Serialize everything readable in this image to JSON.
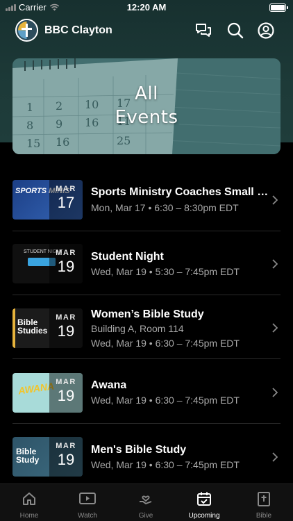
{
  "status_bar": {
    "carrier": "Carrier",
    "time": "12:20 AM"
  },
  "header": {
    "title": "BBC Clayton",
    "icons": [
      "chat-icon",
      "search-icon",
      "profile-icon"
    ]
  },
  "banner": {
    "title_line1": "All",
    "title_line2": "Events"
  },
  "events": [
    {
      "title": "Sports Ministry Coaches Small Group",
      "line1": "Mon, Mar 17 • 6:30 – 8:30pm EDT",
      "line2": "",
      "month": "MAR",
      "day": "17",
      "thumb_text": "SPORTS MINIS"
    },
    {
      "title": "Student Night",
      "line1": "Wed, Mar 19 • 5:30 – 7:45pm EDT",
      "line2": "",
      "month": "MAR",
      "day": "19",
      "thumb_text": "STUDENT NIGHT"
    },
    {
      "title": "Women’s Bible Study",
      "line1": "Building A, Room 114",
      "line2": "Wed, Mar 19 • 6:30 – 7:45pm EDT",
      "month": "MAR",
      "day": "19",
      "thumb_text": "Bible Studies"
    },
    {
      "title": "Awana",
      "line1": "Wed, Mar 19 • 6:30 – 7:45pm EDT",
      "line2": "",
      "month": "MAR",
      "day": "19",
      "thumb_text": "AWANA"
    },
    {
      "title": "Men's Bible Study",
      "line1": "Wed, Mar 19 • 6:30 – 7:45pm EDT",
      "line2": "",
      "month": "MAR",
      "day": "19",
      "thumb_text": "Bible Study"
    }
  ],
  "tabs": [
    {
      "label": "Home",
      "icon": "home-icon",
      "active": false
    },
    {
      "label": "Watch",
      "icon": "play-icon",
      "active": false
    },
    {
      "label": "Give",
      "icon": "give-icon",
      "active": false
    },
    {
      "label": "Upcoming",
      "icon": "calendar-icon",
      "active": true
    },
    {
      "label": "Bible",
      "icon": "bible-icon",
      "active": false
    }
  ],
  "colors": {
    "header_bg": "#1d3a38",
    "background": "#000000",
    "muted_text": "#a9a9a9",
    "tab_inactive": "#8a8a8a"
  }
}
